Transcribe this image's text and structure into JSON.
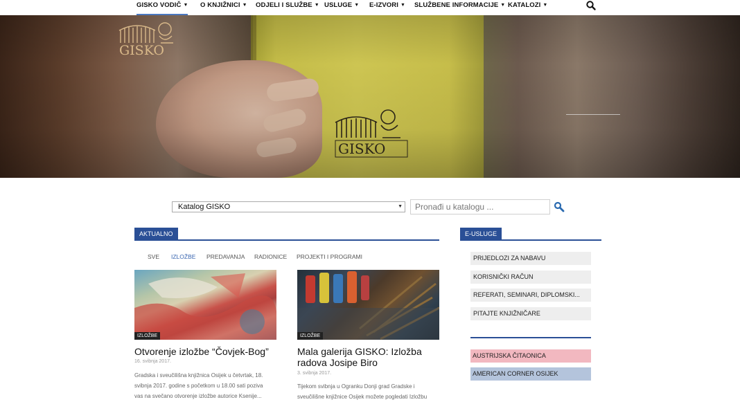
{
  "nav": {
    "items": [
      {
        "label": "GISKO VODIČ",
        "chevron": "chevron-down-icon"
      },
      {
        "label": "O KNJIŽNICI",
        "chevron": "chevron-down-icon"
      },
      {
        "label": "ODJELI I SLUŽBE",
        "chevron": "chevron-down-icon"
      },
      {
        "label": "USLUGE",
        "chevron": "chevron-down-icon"
      },
      {
        "label": "E-IZVORI",
        "chevron": "chevron-down-icon"
      },
      {
        "label": "SLUŽBENE INFORMACIJE",
        "chevron": "chevron-down-icon"
      },
      {
        "label": "KATALOZI",
        "chevron": "chevron-down-icon"
      }
    ],
    "search_icon": "search-icon",
    "active_color": "#4a78c0"
  },
  "hero": {
    "logo_text": "GISKO",
    "book_logo_text": "GISKO"
  },
  "search": {
    "catalog_selected": "Katalog GISKO",
    "placeholder": "Pronađi u katalogu ..."
  },
  "aktualno": {
    "title": "AKTUALNO",
    "filters": [
      "SVE",
      "IZLOŽBE",
      "PREDAVANJA",
      "RADIONICE",
      "PROJEKTI I PROGRAMI"
    ],
    "active_filter": "IZLOŽBE",
    "articles": [
      {
        "tag": "IZLOŽBE",
        "title": "Otvorenje izložbe “Čovjek-Bog”",
        "date": "16. svibnja 2017.",
        "excerpt_lines": [
          "Gradska i sveučilišna knjižnica Osijek u četvrtak, 18.",
          "svibnja 2017. godine s početkom u 18.00 sati poziva",
          "vas na svečano otvorenje izložbe autorice Ksenije..."
        ]
      },
      {
        "tag": "IZLOŽBE",
        "title_lines": [
          "Mala galerija GISKO: Izložba",
          "radova Josipe Biro"
        ],
        "date": "3. svibnja 2017.",
        "excerpt_lines": [
          "Tijekom svibnja u Ogranku Donji grad Gradske i",
          "sveučilišne knjižnice Osijek možete pogledati Izložbu"
        ]
      }
    ]
  },
  "sidebar": {
    "title": "E-USLUGE",
    "items": [
      "PRIJEDLOZI ZA NABAVU",
      "KORISNIČKI RAČUN",
      "REFERATI, SEMINARI, DIPLOMSKI...",
      "PITAJTE KNJIŽNIČARE"
    ],
    "links": [
      {
        "label": "AUSTRIJSKA ČITAONICA",
        "color": "#f2b8c0"
      },
      {
        "label": "AMERICAN CORNER OSIJEK",
        "color": "#b4c4dc"
      }
    ]
  },
  "colors": {
    "accent": "#2a4f96",
    "filter_active": "#3a66b0"
  }
}
